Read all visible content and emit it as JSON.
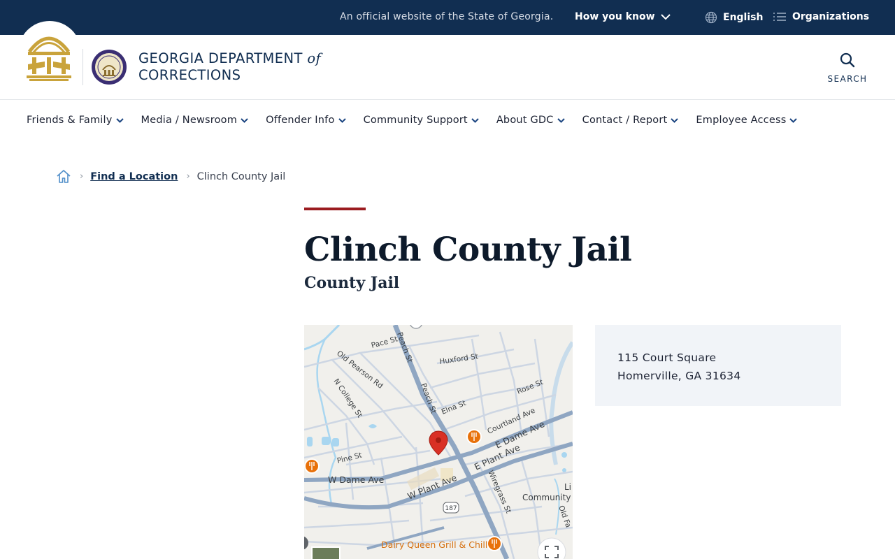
{
  "banner": {
    "official_text": "An official website of the State of Georgia.",
    "how_you_know": "How you know",
    "language": "English",
    "organizations": "Organizations"
  },
  "header": {
    "agency_line1": "GEORGIA DEPARTMENT",
    "agency_of": "of",
    "agency_line2": "CORRECTIONS",
    "search_label": "SEARCH"
  },
  "nav": {
    "items": [
      {
        "label": "Friends & Family"
      },
      {
        "label": "Media / Newsroom"
      },
      {
        "label": "Offender Info"
      },
      {
        "label": "Community Support"
      },
      {
        "label": "About GDC"
      },
      {
        "label": "Contact / Report"
      },
      {
        "label": "Employee Access"
      }
    ]
  },
  "breadcrumb": {
    "home_icon": "home-icon",
    "parent": "Find a Location",
    "current": "Clinch County Jail"
  },
  "page": {
    "title": "Clinch County Jail",
    "subtitle": "County Jail"
  },
  "map": {
    "streets": {
      "pace": "Pace St",
      "peach1": "Peach St",
      "peach2": "Peach St",
      "huxford": "Huxford St",
      "old_pearson": "Old Pearson Rd",
      "n_college": "N College St",
      "elna": "Elna St",
      "rose": "Rose St",
      "courtland": "Courtland Ave",
      "e_dame": "E Dame Ave",
      "e_plant": "E Plant Ave",
      "pine": "Pine St",
      "w_dame": "W Dame Ave",
      "w_plant": "W Plant Ave",
      "wiregrass": "Wiregrass St",
      "route": "187",
      "old_fa": "Old Fa",
      "li": "Li",
      "community": "Community"
    },
    "poi": "Dairy Queen Grill & Chill",
    "accent_orange": "#e8710a",
    "pin_color": "#d93025"
  },
  "address": {
    "line1": "115 Court Square",
    "line2": "Homerville, GA 31634"
  },
  "colors": {
    "banner_bg": "#112e51",
    "rule_red": "#9b1c20",
    "card_bg": "#f1f4f8"
  }
}
